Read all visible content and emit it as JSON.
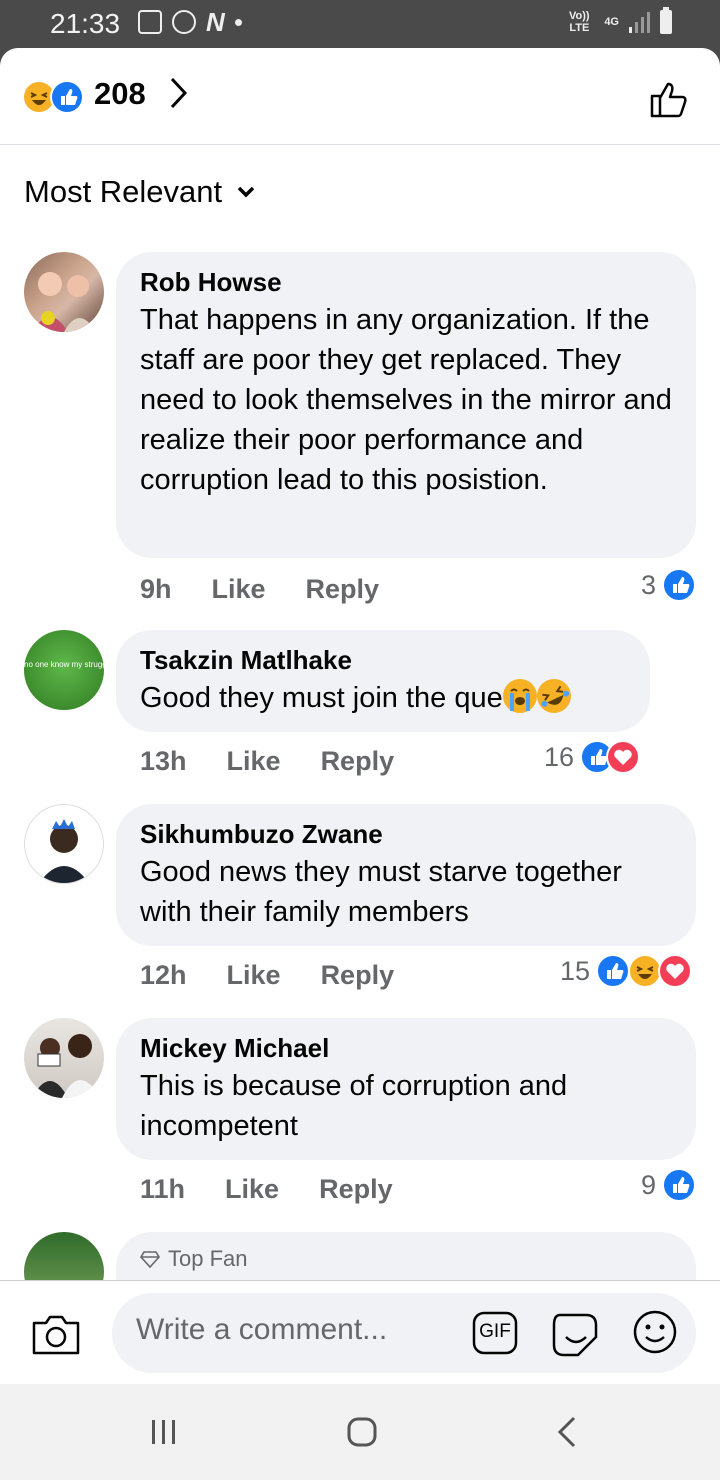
{
  "status_bar": {
    "time": "21:33",
    "network_label": "4G",
    "volte_label": "Vo)) LTE",
    "n_app_label": "N"
  },
  "header": {
    "reaction_count": "208",
    "icons": [
      "haha-reaction-icon",
      "like-reaction-icon"
    ]
  },
  "sort": {
    "label": "Most Relevant"
  },
  "comments": [
    {
      "author": "Rob Howse",
      "text": "That happens in any organization. If the staff are poor they get replaced. They need to look themselves in the mirror and realize their poor performance and corruption lead to this posistion.",
      "time": "9h",
      "like": "Like",
      "reply": "Reply",
      "reactions_count": "3",
      "reactions": [
        "like"
      ]
    },
    {
      "author": "Tsakzin Matlhake",
      "text": "Good they must join the que",
      "time": "13h",
      "like": "Like",
      "reply": "Reply",
      "reactions_count": "16",
      "reactions": [
        "like",
        "love"
      ],
      "avatar_text": "no one know my struggle"
    },
    {
      "author": "Sikhumbuzo Zwane",
      "text": "Good news they must starve together with their family members",
      "time": "12h",
      "like": "Like",
      "reply": "Reply",
      "reactions_count": "15",
      "reactions": [
        "like",
        "haha",
        "love"
      ]
    },
    {
      "author": "Mickey Michael",
      "text": "This is because of corruption and incompetent",
      "time": "11h",
      "like": "Like",
      "reply": "Reply",
      "reactions_count": "9",
      "reactions": [
        "like"
      ]
    },
    {
      "badge": "Top Fan"
    }
  ],
  "composer": {
    "placeholder": "Write a comment...",
    "gif_label": "GIF"
  },
  "colors": {
    "like": "#1877f2",
    "love": "#f33e58",
    "haha": "#f7b125",
    "bubble": "#f0f2f5",
    "meta": "#65676b"
  }
}
